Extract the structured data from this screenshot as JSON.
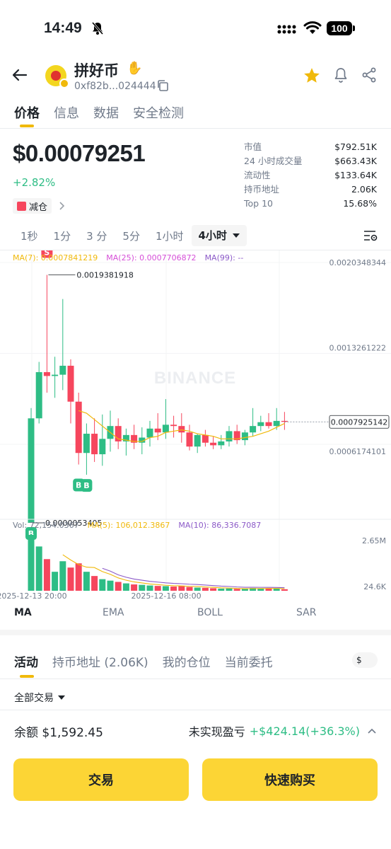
{
  "status_bar": {
    "time": "14:49",
    "battery": "100"
  },
  "header": {
    "coin_name": "拼好币",
    "contract": "0xf82b...024444"
  },
  "main_tabs": [
    {
      "label": "价格",
      "active": true
    },
    {
      "label": "信息",
      "active": false
    },
    {
      "label": "数据",
      "active": false
    },
    {
      "label": "安全检测",
      "active": false
    }
  ],
  "price": {
    "value": "$0.00079251",
    "change": "+2.82%",
    "badge": "减仓"
  },
  "stats": [
    {
      "label": "市值",
      "value": "$792.51K"
    },
    {
      "label": "24 小时成交量",
      "value": "$663.43K"
    },
    {
      "label": "流动性",
      "value": "$133.64K"
    },
    {
      "label": "持币地址",
      "value": "2.06K"
    },
    {
      "label": "Top 10",
      "value": "15.68%"
    }
  ],
  "time_tabs": [
    {
      "label": "1秒",
      "active": false
    },
    {
      "label": "1分",
      "active": false
    },
    {
      "label": "3 分",
      "active": false
    },
    {
      "label": "5分",
      "active": false
    },
    {
      "label": "1小时",
      "active": false
    },
    {
      "label": "4小时",
      "active": true
    }
  ],
  "colors": {
    "up": "#2ebd85",
    "down": "#f6465d",
    "ma7": "#f0b90b",
    "ma25": "#d64fd8",
    "ma99": "#8c5ac8",
    "accent": "#fcd535"
  },
  "chart_data": {
    "type": "candlestick",
    "ma_legend": {
      "ma7": "MA(7): 0.0007841219",
      "ma25": "MA(25): 0.0007706872",
      "ma99": "MA(99): --"
    },
    "y_axis_labels": [
      "0.0020348344",
      "0.0013261222",
      "0.0006174101"
    ],
    "ylim": [
      0.0,
      0.0020348344
    ],
    "current_price_label": "0.0007925142",
    "high_annotation": "0.0019381918",
    "low_annotation": "0.0000053405",
    "watermark": "BINANCE",
    "candles": [
      {
        "o": 5.3e-06,
        "h": 0.0009,
        "l": 5.3e-06,
        "c": 0.00082
      },
      {
        "o": 0.00082,
        "h": 0.00126,
        "l": 0.00078,
        "c": 0.00118
      },
      {
        "o": 0.00118,
        "h": 0.0019381918,
        "l": 0.00102,
        "c": 0.00115
      },
      {
        "o": 0.00115,
        "h": 0.0013,
        "l": 0.00098,
        "c": 0.00116
      },
      {
        "o": 0.00116,
        "h": 0.00175,
        "l": 0.00104,
        "c": 0.00123
      },
      {
        "o": 0.00123,
        "h": 0.00128,
        "l": 0.00078,
        "c": 0.00095
      },
      {
        "o": 0.00095,
        "h": 0.00102,
        "l": 0.00046,
        "c": 0.00055
      },
      {
        "o": 0.00055,
        "h": 0.00078,
        "l": 0.00038,
        "c": 0.0007
      },
      {
        "o": 0.0007,
        "h": 0.00082,
        "l": 0.00048,
        "c": 0.00054
      },
      {
        "o": 0.00054,
        "h": 0.00085,
        "l": 0.00045,
        "c": 0.00066
      },
      {
        "o": 0.00066,
        "h": 0.00088,
        "l": 0.00056,
        "c": 0.00076
      },
      {
        "o": 0.00076,
        "h": 0.00082,
        "l": 0.00058,
        "c": 0.00064
      },
      {
        "o": 0.00064,
        "h": 0.00074,
        "l": 0.00053,
        "c": 0.00069
      },
      {
        "o": 0.00069,
        "h": 0.00077,
        "l": 0.00058,
        "c": 0.00063
      },
      {
        "o": 0.00063,
        "h": 0.00075,
        "l": 0.00054,
        "c": 0.00067
      },
      {
        "o": 0.00067,
        "h": 0.0008,
        "l": 0.0006,
        "c": 0.00074
      },
      {
        "o": 0.00074,
        "h": 0.00086,
        "l": 0.00065,
        "c": 0.00071
      },
      {
        "o": 0.00071,
        "h": 0.00097,
        "l": 0.00066,
        "c": 0.00077
      },
      {
        "o": 0.00077,
        "h": 0.00084,
        "l": 0.00067,
        "c": 0.00076
      },
      {
        "o": 0.00076,
        "h": 0.00086,
        "l": 0.00063,
        "c": 0.00071
      },
      {
        "o": 0.00071,
        "h": 0.00077,
        "l": 0.00057,
        "c": 0.0006
      },
      {
        "o": 0.0006,
        "h": 0.0007,
        "l": 0.00055,
        "c": 0.00069
      },
      {
        "o": 0.00069,
        "h": 0.00073,
        "l": 0.0006,
        "c": 0.00063
      },
      {
        "o": 0.00063,
        "h": 0.00068,
        "l": 0.00058,
        "c": 0.00061
      },
      {
        "o": 0.00061,
        "h": 0.00069,
        "l": 0.00058,
        "c": 0.00064
      },
      {
        "o": 0.00064,
        "h": 0.00076,
        "l": 0.0006,
        "c": 0.00072
      },
      {
        "o": 0.00072,
        "h": 0.00077,
        "l": 0.00062,
        "c": 0.00065
      },
      {
        "o": 0.00065,
        "h": 0.00073,
        "l": 0.00061,
        "c": 0.00071
      },
      {
        "o": 0.00071,
        "h": 0.0009,
        "l": 0.00068,
        "c": 0.00076
      },
      {
        "o": 0.00076,
        "h": 0.00084,
        "l": 0.00072,
        "c": 0.00079
      },
      {
        "o": 0.00079,
        "h": 0.00086,
        "l": 0.00074,
        "c": 0.00076
      },
      {
        "o": 0.00076,
        "h": 0.0009,
        "l": 0.00073,
        "c": 0.0008
      },
      {
        "o": 0.0008,
        "h": 0.00087,
        "l": 0.00073,
        "c": 0.0007925
      }
    ],
    "ma7_values": [
      null,
      null,
      null,
      null,
      null,
      null,
      0.00088,
      0.00086,
      0.00081,
      0.00076,
      0.00071,
      0.00066,
      0.00065,
      0.00064,
      0.00064,
      0.00067,
      0.00068,
      0.00071,
      0.00072,
      0.00073,
      0.00072,
      0.0007,
      0.00069,
      0.00068,
      0.00066,
      0.00066,
      0.00066,
      0.00067,
      0.00068,
      0.0007,
      0.00072,
      0.00075,
      0.00078
    ],
    "volume_legend": {
      "vol": "Vol: 72,154.0367",
      "ma5": "MA(5): 106,012.3867",
      "ma10": "MA(10): 86,336.7087"
    },
    "volume_axis": [
      "2.65M",
      "24.6K"
    ],
    "volume_max": 2650000,
    "volumes": [
      2650000,
      2100000,
      1500000,
      900000,
      1400000,
      1100000,
      1300000,
      900000,
      700000,
      550000,
      480000,
      420000,
      350000,
      300000,
      280000,
      250000,
      230000,
      220000,
      200000,
      240000,
      180000,
      150000,
      140000,
      120000,
      100000,
      110000,
      90000,
      100000,
      130000,
      110000,
      120000,
      100000,
      72154
    ],
    "vol_ma5": [
      null,
      null,
      null,
      null,
      1710000,
      1460000,
      1240000,
      1120000,
      1100000,
      910000,
      780000,
      610000,
      500000,
      420000,
      370000,
      320000,
      290000,
      260000,
      240000,
      230000,
      210000,
      200000,
      180000,
      160000,
      140000,
      130000,
      110000,
      100000,
      105000,
      108000,
      110000,
      112000,
      106012
    ],
    "x_axis_labels": [
      "2025-12-13 20:00",
      "2025-12-16 08:00"
    ],
    "markers": [
      {
        "type": "S",
        "index": 2
      },
      {
        "type": "B",
        "index": 0
      },
      {
        "type": "B",
        "index": 6
      },
      {
        "type": "B",
        "index": 7
      }
    ]
  },
  "indicator_tabs": [
    {
      "label": "MA",
      "active": true
    },
    {
      "label": "EMA",
      "active": false
    },
    {
      "label": "BOLL",
      "active": false
    },
    {
      "label": "SAR",
      "active": false
    }
  ],
  "activity_tabs": [
    {
      "label": "活动",
      "active": true
    },
    {
      "label": "持币地址 (2.06K)",
      "active": false
    },
    {
      "label": "我的仓位",
      "active": false
    },
    {
      "label": "当前委托",
      "active": false
    }
  ],
  "currency_toggle": "$",
  "filter_label": "全部交易",
  "balance": {
    "label": "余额",
    "value": "$1,592.45"
  },
  "pnl": {
    "label": "未实现盈亏",
    "value": "+$424.14(+36.3%)"
  },
  "buttons": {
    "trade": "交易",
    "quick_buy": "快速购买"
  }
}
